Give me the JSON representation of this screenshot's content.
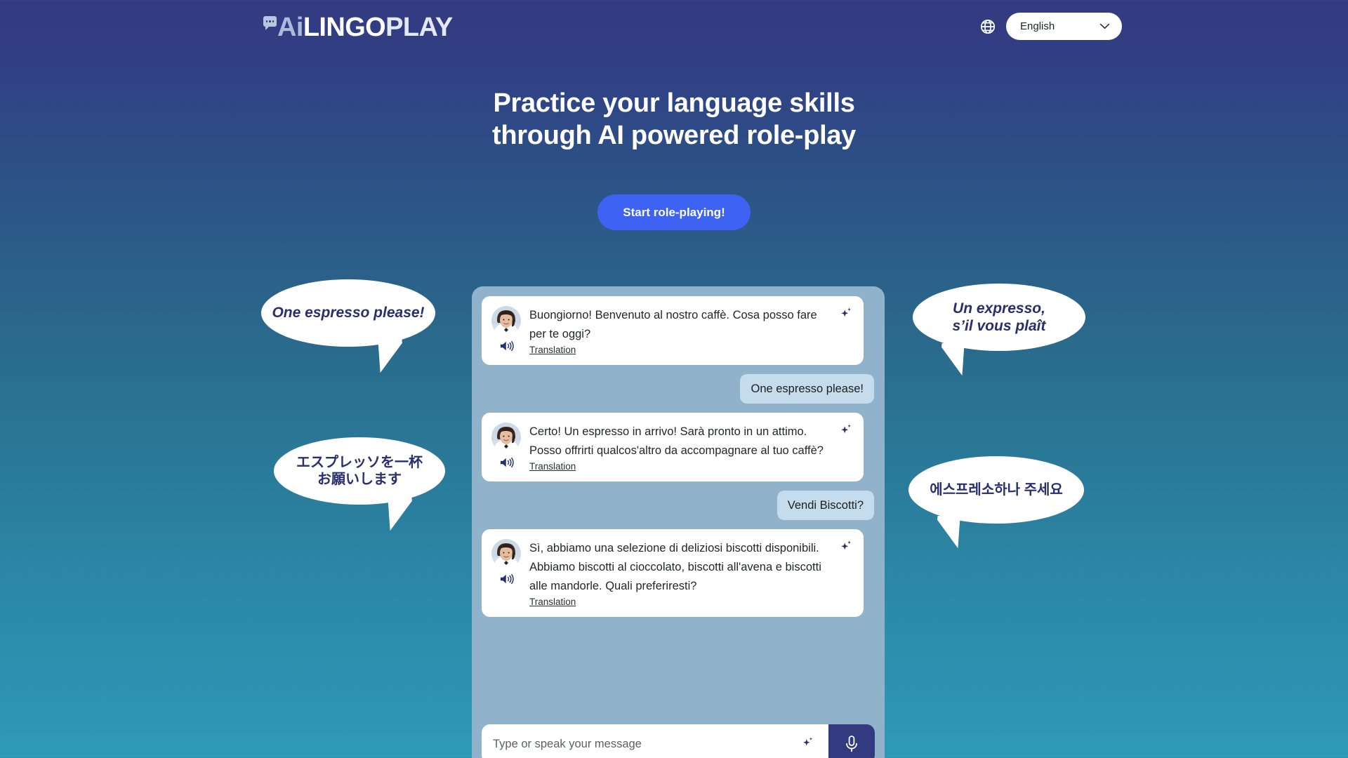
{
  "brand": {
    "logo_ai": "Ai",
    "logo_lingo": "LINGO",
    "logo_play": "PLAY",
    "bubble_icon": "speech-bubble-icon"
  },
  "header": {
    "globe_icon": "globe-icon",
    "language_value": "English",
    "chevron_icon": "chevron-down-icon"
  },
  "hero": {
    "line1": "Practice your language skills",
    "line2": "through AI powered role-play",
    "cta_label": "Start role-playing!"
  },
  "chat": {
    "messages": [
      {
        "role": "assistant",
        "text": "Buongiorno! Benvenuto al nostro caffè. Cosa posso fare per te oggi?",
        "translation_label": "Translation",
        "speaker_icon": "speaker-icon",
        "sparkle_icon": "sparkle-icon",
        "avatar": "avatar"
      },
      {
        "role": "user",
        "text": "One espresso please!"
      },
      {
        "role": "assistant",
        "text": "Certo! Un espresso in arrivo! Sarà pronto in un attimo. Posso offrirti qualcos'altro da accompagnare al tuo caffè?",
        "translation_label": "Translation",
        "speaker_icon": "speaker-icon",
        "sparkle_icon": "sparkle-icon",
        "avatar": "avatar"
      },
      {
        "role": "user",
        "text": "Vendi Biscotti?"
      },
      {
        "role": "assistant",
        "text": "Sì, abbiamo una selezione di deliziosi biscotti disponibili. Abbiamo biscotti al cioccolato, biscotti all'avena e biscotti alle mandorle. Quali preferiresti?",
        "translation_label": "Translation",
        "speaker_icon": "speaker-icon",
        "sparkle_icon": "sparkle-icon",
        "avatar": "avatar"
      }
    ],
    "input_placeholder": "Type or speak your message",
    "input_value": "",
    "input_sparkle_icon": "sparkle-icon",
    "mic_icon": "microphone-icon"
  },
  "callouts": [
    {
      "id": "en",
      "text": "One espresso please!"
    },
    {
      "id": "ja",
      "text": "エスプレッソを一杯\nお願いします"
    },
    {
      "id": "fr",
      "text": "Un expresso,\ns’il vous plaît"
    },
    {
      "id": "ko",
      "text": "에스프레소하나 주세요"
    }
  ],
  "colors": {
    "gradient_top": "#343a80",
    "gradient_bottom": "#2f9ab9",
    "cta": "#3e63f2",
    "chat_panel": "#90b2ca",
    "user_bubble": "#c4dcec",
    "mic_button": "#343a80",
    "callout_text": "#2a2e6e"
  }
}
